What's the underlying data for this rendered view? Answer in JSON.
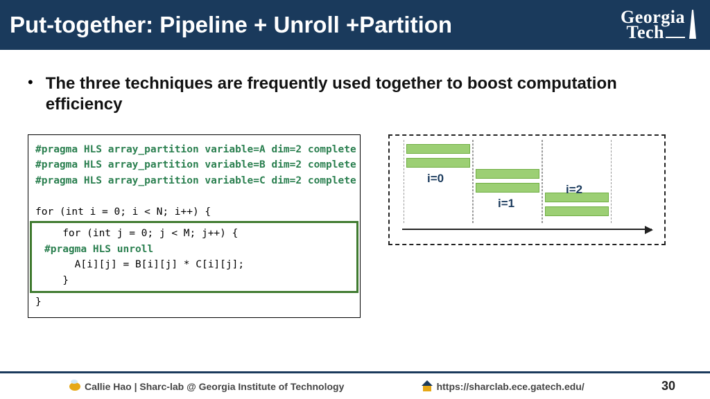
{
  "header": {
    "title": "Put-together: Pipeline + Unroll +Partition",
    "logo_line1": "Georgia",
    "logo_line2": "Tech"
  },
  "bullet": "The three techniques are frequently used together to boost computation efficiency",
  "code": {
    "pragma1": "#pragma HLS array_partition variable=A dim=2 complete",
    "pragma2": "#pragma HLS array_partition variable=B dim=2 complete",
    "pragma3": "#pragma HLS array_partition variable=C dim=2 complete",
    "loop_outer": "for (int i = 0; i < N; i++) {",
    "loop_inner_open": "   for (int j = 0; j < M; j++) {",
    "pragma_unroll": "#pragma HLS unroll",
    "body_line": "     A[i][j] = B[i][j] * C[i][j];",
    "inner_close": "   }",
    "outer_close": "}"
  },
  "diagram": {
    "label0": "i=0",
    "label1": "i=1",
    "label2": "i=2"
  },
  "footer": {
    "left": "Callie Hao | Sharc-lab @ Georgia Institute of Technology",
    "mid": "https://sharclab.ece.gatech.edu/",
    "page": "30"
  }
}
